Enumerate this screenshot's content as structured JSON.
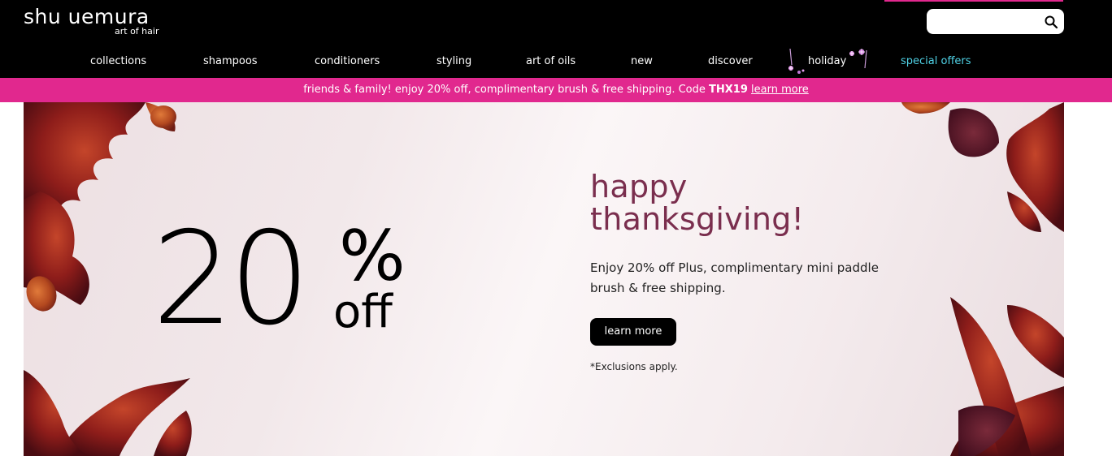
{
  "brand": {
    "name": "shu uemura",
    "tagline": "art of hair"
  },
  "search": {
    "placeholder": "",
    "icon": "search-icon"
  },
  "nav": {
    "items": [
      {
        "label": "collections"
      },
      {
        "label": "shampoos"
      },
      {
        "label": "conditioners"
      },
      {
        "label": "styling"
      },
      {
        "label": "art of oils"
      },
      {
        "label": "new"
      },
      {
        "label": "discover"
      },
      {
        "label": "holiday"
      },
      {
        "label": "special offers"
      }
    ]
  },
  "promo": {
    "text": "friends & family! enjoy 20% off, complimentary brush & free shipping. Code ",
    "code": "THX19",
    "link": "learn more"
  },
  "hero": {
    "big_number": "20",
    "percent": "%",
    "off": "off",
    "headline_line1": "happy",
    "headline_line2": "thanksgiving!",
    "description": "Enjoy 20% off Plus, complimentary mini paddle brush & free shipping.",
    "cta": "learn more",
    "note": "*Exclusions apply."
  },
  "colors": {
    "header_bg": "#000000",
    "promo_bg": "#e1288e",
    "special_offers": "#4fd2e6",
    "headline": "#7a2e4e",
    "leaf": "#8e1d1a"
  }
}
